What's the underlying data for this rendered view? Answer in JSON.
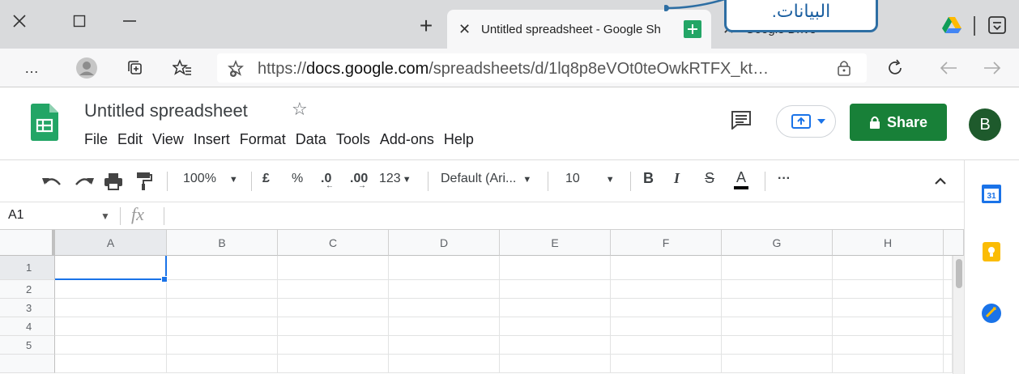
{
  "browser": {
    "active_tab_title": "Untitled spreadsheet - Google Sh",
    "second_tab_title": "Google Drive",
    "new_tab_label": "+",
    "url_prefix": "https://",
    "url_host": "docs.google.com",
    "url_path": "/spreadsheets/d/1lq8p8eVOt0teOwkRTFX_kt…",
    "menu_dots": "…"
  },
  "callout": {
    "text": "البيانات."
  },
  "sheets": {
    "title": "Untitled spreadsheet",
    "menu": [
      "File",
      "Edit",
      "View",
      "Insert",
      "Format",
      "Data",
      "Tools",
      "Add-ons",
      "Help"
    ],
    "share_label": "Share",
    "avatar_letter": "B",
    "accent_green": "#188038"
  },
  "toolbar": {
    "zoom": "100%",
    "currency": "£",
    "percent": "%",
    "dec_decrease": ".0",
    "dec_increase": ".00",
    "number_format": "123",
    "font": "Default (Ari...",
    "font_size": "10",
    "bold": "B",
    "italic": "I",
    "strike": "S",
    "text_color": "A",
    "more": "···"
  },
  "formula_bar": {
    "name_box": "A1",
    "fx": "fx"
  },
  "grid": {
    "columns": [
      "A",
      "B",
      "C",
      "D",
      "E",
      "F",
      "G",
      "H"
    ],
    "rows": [
      "1",
      "2",
      "3",
      "4",
      "5"
    ],
    "selected_cell": "A1"
  }
}
